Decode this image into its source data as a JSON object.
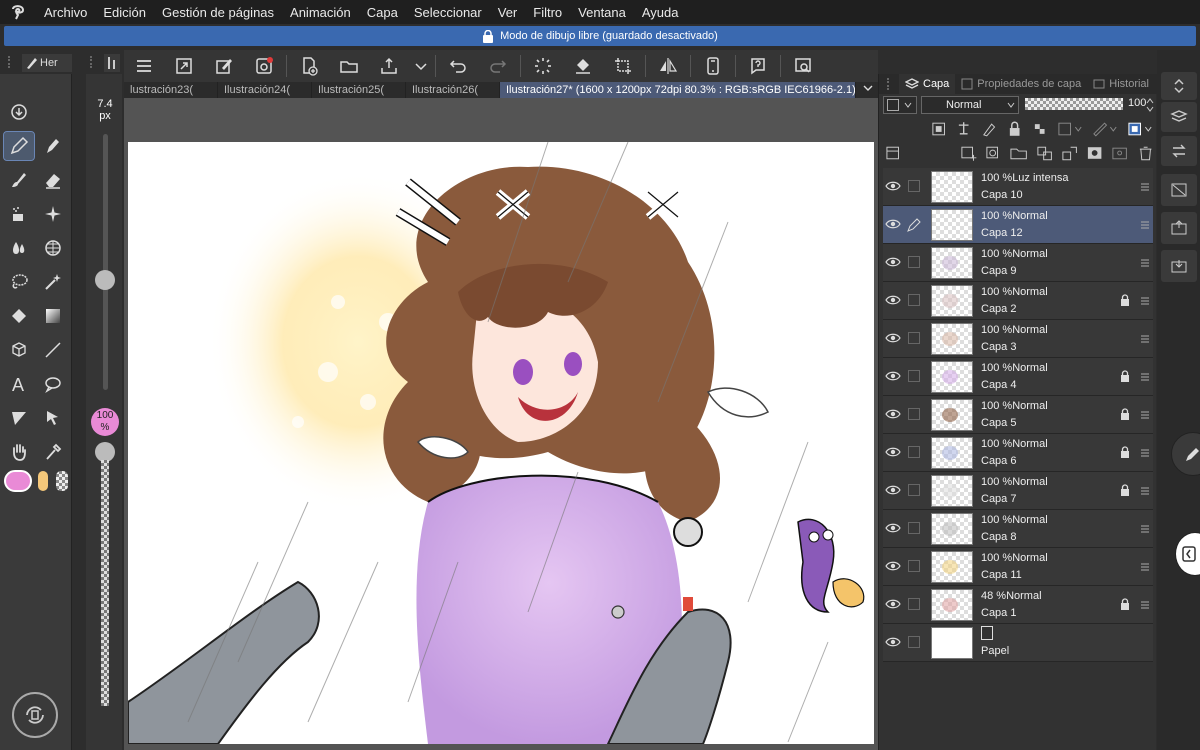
{
  "menu": [
    "Archivo",
    "Edición",
    "Gestión de páginas",
    "Animación",
    "Capa",
    "Seleccionar",
    "Ver",
    "Filtro",
    "Ventana",
    "Ayuda"
  ],
  "banner": "Modo de dibujo libre (guardado desactivado)",
  "tool_panel_title": "Her",
  "brush_size": {
    "value": "7.4",
    "unit": "px"
  },
  "opacity": {
    "value": "100",
    "unit": "%"
  },
  "tabs": [
    {
      "label": "lustración23(",
      "active": false
    },
    {
      "label": "Ilustración24(",
      "active": false
    },
    {
      "label": "Ilustración25(",
      "active": false
    },
    {
      "label": "Ilustración26(",
      "active": false
    },
    {
      "label": "Ilustración27* (1600 x 1200px 72dpi 80.3% : RGB:sRGB IEC61966-2.1)",
      "active": true
    }
  ],
  "right_tabs": {
    "layer": "Capa",
    "properties": "Propiedades de capa",
    "history": "Historial"
  },
  "blend_mode": "Normal",
  "layer_opacity": "100",
  "layers": [
    {
      "mode": "100 %Luz intensa",
      "name": "Capa 10",
      "selected": false,
      "locked": false
    },
    {
      "mode": "100 %Normal",
      "name": "Capa 12",
      "selected": true,
      "locked": false
    },
    {
      "mode": "100 %Normal",
      "name": "Capa 9",
      "selected": false,
      "locked": false
    },
    {
      "mode": "100 %Normal",
      "name": "Capa 2",
      "selected": false,
      "locked": true
    },
    {
      "mode": "100 %Normal",
      "name": "Capa 3",
      "selected": false,
      "locked": false
    },
    {
      "mode": "100 %Normal",
      "name": "Capa 4",
      "selected": false,
      "locked": true
    },
    {
      "mode": "100 %Normal",
      "name": "Capa 5",
      "selected": false,
      "locked": true
    },
    {
      "mode": "100 %Normal",
      "name": "Capa 6",
      "selected": false,
      "locked": true
    },
    {
      "mode": "100 %Normal",
      "name": "Capa 7",
      "selected": false,
      "locked": true
    },
    {
      "mode": "100 %Normal",
      "name": "Capa 8",
      "selected": false,
      "locked": false
    },
    {
      "mode": "100 %Normal",
      "name": "Capa 11",
      "selected": false,
      "locked": false
    },
    {
      "mode": "48 %Normal",
      "name": "Capa 1",
      "selected": false,
      "locked": true
    },
    {
      "mode": "",
      "name": "Papel",
      "selected": false,
      "locked": false
    }
  ],
  "colors": {
    "main_color": "#e98ad6",
    "sub_color": "#f5c87a",
    "accent": "#3a69b0"
  }
}
